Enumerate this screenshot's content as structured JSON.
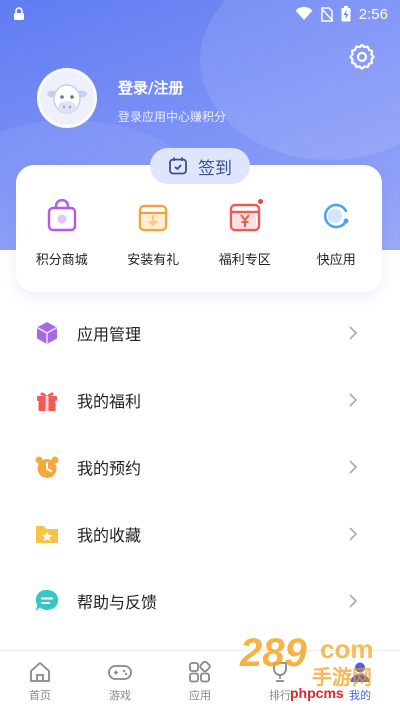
{
  "status_bar": {
    "time": "2:56"
  },
  "profile": {
    "title": "登录/注册",
    "subtitle": "登录应用中心赚积分"
  },
  "checkin": {
    "label": "签到"
  },
  "quick_actions": [
    {
      "label": "积分商城",
      "icon": "shopping-bag-icon",
      "color": "#b657e8"
    },
    {
      "label": "安装有礼",
      "icon": "gift-box-icon",
      "color": "#f0a43a"
    },
    {
      "label": "福利专区",
      "icon": "yen-gift-icon",
      "color": "#ef5a55",
      "badge": true
    },
    {
      "label": "快应用",
      "icon": "quick-app-icon",
      "color": "#4aa3f0"
    }
  ],
  "menu": [
    {
      "label": "应用管理",
      "icon": "cube-icon",
      "color": "#a768e8"
    },
    {
      "label": "我的福利",
      "icon": "gift-icon",
      "color": "#f25a5a"
    },
    {
      "label": "我的预约",
      "icon": "alarm-clock-icon",
      "color": "#f6a93b"
    },
    {
      "label": "我的收藏",
      "icon": "star-folder-icon",
      "color": "#f7c543"
    },
    {
      "label": "帮助与反馈",
      "icon": "chat-bubble-icon",
      "color": "#35c6c8"
    }
  ],
  "bottom_nav": [
    {
      "label": "首页",
      "icon": "home-icon"
    },
    {
      "label": "游戏",
      "icon": "gamepad-icon"
    },
    {
      "label": "应用",
      "icon": "apps-grid-icon"
    },
    {
      "label": "排行",
      "icon": "trophy-icon"
    },
    {
      "label": "我的",
      "icon": "user-icon",
      "active": true
    }
  ],
  "watermark": {
    "text": "phpcms"
  },
  "colors": {
    "header": "#6d86f4",
    "accent": "#4a62e8"
  }
}
